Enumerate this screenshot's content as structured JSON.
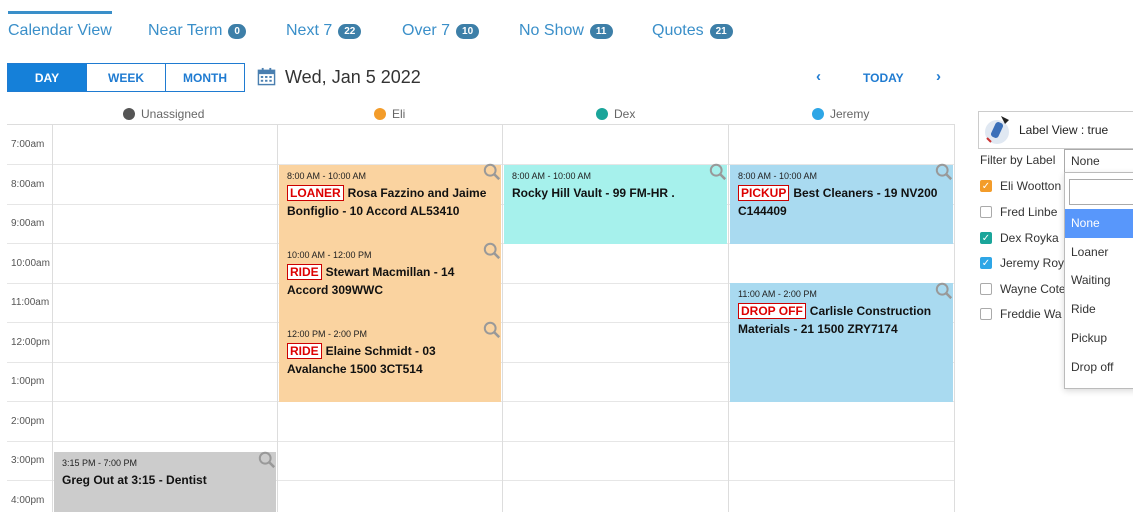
{
  "tabs": [
    {
      "label": "Calendar View",
      "badge": ""
    },
    {
      "label": "Near Term",
      "badge": "0"
    },
    {
      "label": "Next 7",
      "badge": "22"
    },
    {
      "label": "Over 7",
      "badge": "10"
    },
    {
      "label": "No Show",
      "badge": "11"
    },
    {
      "label": "Quotes",
      "badge": "21"
    }
  ],
  "view_buttons": [
    "DAY",
    "WEEK",
    "MONTH"
  ],
  "date_title": "Wed, Jan 5 2022",
  "nav": {
    "prev": "‹",
    "today": "TODAY",
    "next": "›"
  },
  "resources": [
    {
      "name": "Unassigned",
      "color": "#555555"
    },
    {
      "name": "Eli",
      "color": "#f39c2a"
    },
    {
      "name": "Dex",
      "color": "#1aa59a"
    },
    {
      "name": "Jeremy",
      "color": "#2ea6e6"
    }
  ],
  "times": [
    "7:00am",
    "8:00am",
    "9:00am",
    "10:00am",
    "11:00am",
    "12:00pm",
    "1:00pm",
    "2:00pm",
    "3:00pm",
    "4:00pm"
  ],
  "events": [
    {
      "time": "8:00 AM - 10:00 AM",
      "tag": "LOANER",
      "title": "Rosa Fazzino and Jaime Bonfiglio - 10 Accord AL53410",
      "color": "#fad3a0"
    },
    {
      "time": "10:00 AM - 12:00 PM",
      "tag": "RIDE",
      "title": "Stewart Macmillan - 14 Accord 309WWC",
      "color": "#fad3a0"
    },
    {
      "time": "12:00 PM - 2:00 PM",
      "tag": "RIDE",
      "title": "Elaine Schmidt - 03 Avalanche 1500 3CT514",
      "color": "#fad3a0"
    },
    {
      "time": "8:00 AM - 10:00 AM",
      "tag": "",
      "title": "Rocky Hill Vault - 99 FM-HR .",
      "color": "#a6f1ec"
    },
    {
      "time": "8:00 AM - 10:00 AM",
      "tag": "PICKUP",
      "title": "Best Cleaners - 19 NV200 C144409",
      "color": "#a9daf0"
    },
    {
      "time": "11:00 AM - 2:00 PM",
      "tag": "DROP OFF",
      "title": "Carlisle Construction Materials - 21 1500 ZRY7174",
      "color": "#a9daf0"
    },
    {
      "time": "3:15 PM - 7:00 PM",
      "tag": "",
      "title": "Greg Out at 3:15 - Dentist",
      "color": "#cccccc"
    }
  ],
  "label_view": "Label View : true",
  "filter_label": "Filter by Label",
  "filter_value": "None",
  "people": [
    {
      "name": "Eli Wootton",
      "checked": true,
      "color": "#f39c2a"
    },
    {
      "name": "Fred Linbe",
      "checked": false,
      "color": ""
    },
    {
      "name": "Dex Royka",
      "checked": true,
      "color": "#1aa59a"
    },
    {
      "name": "Jeremy Roy",
      "checked": true,
      "color": "#2ea6e6"
    },
    {
      "name": "Wayne Cote",
      "checked": false,
      "color": ""
    },
    {
      "name": "Freddie Wa",
      "checked": false,
      "color": ""
    }
  ],
  "dropdown_options": [
    "None",
    "Loaner",
    "Waiting",
    "Ride",
    "Pickup",
    "Drop off"
  ]
}
